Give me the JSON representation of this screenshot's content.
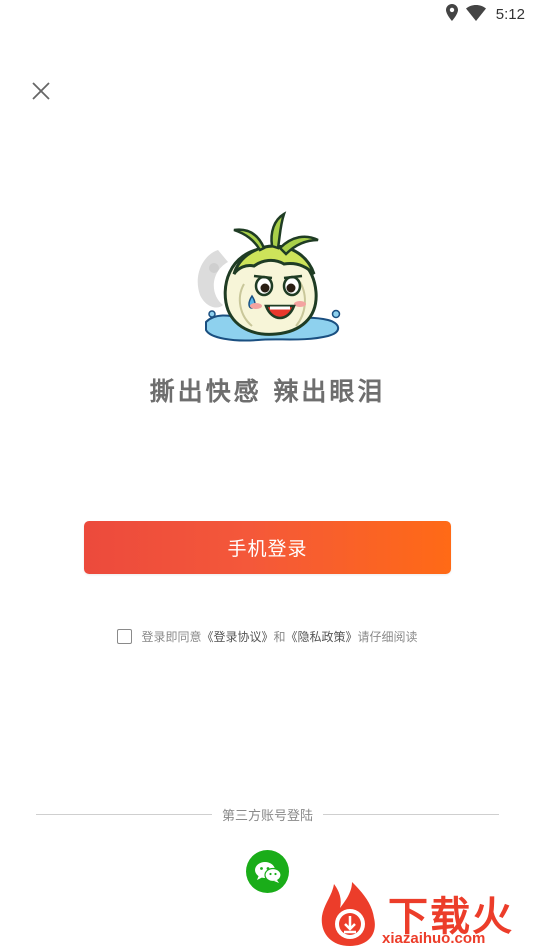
{
  "status_bar": {
    "time": "5:12"
  },
  "branding": {
    "slogan": "撕出快感 辣出眼泪"
  },
  "login": {
    "phone_button_label": "手机登录"
  },
  "agreement": {
    "prefix": "登录即同意",
    "terms_link": "《登录协议》",
    "conjunction": "和",
    "privacy_link": "《隐私政策》",
    "suffix": "请仔细阅读",
    "checked": false
  },
  "third_party": {
    "label": "第三方账号登陆",
    "providers": [
      "wechat-icon"
    ]
  },
  "watermark": {
    "text": "下载火",
    "url": "xiazaihuo.com"
  },
  "colors": {
    "primary_start": "#ec4a3c",
    "primary_end": "#ff6a16",
    "wechat": "#1aad19",
    "watermark": "#ec3d2a"
  }
}
